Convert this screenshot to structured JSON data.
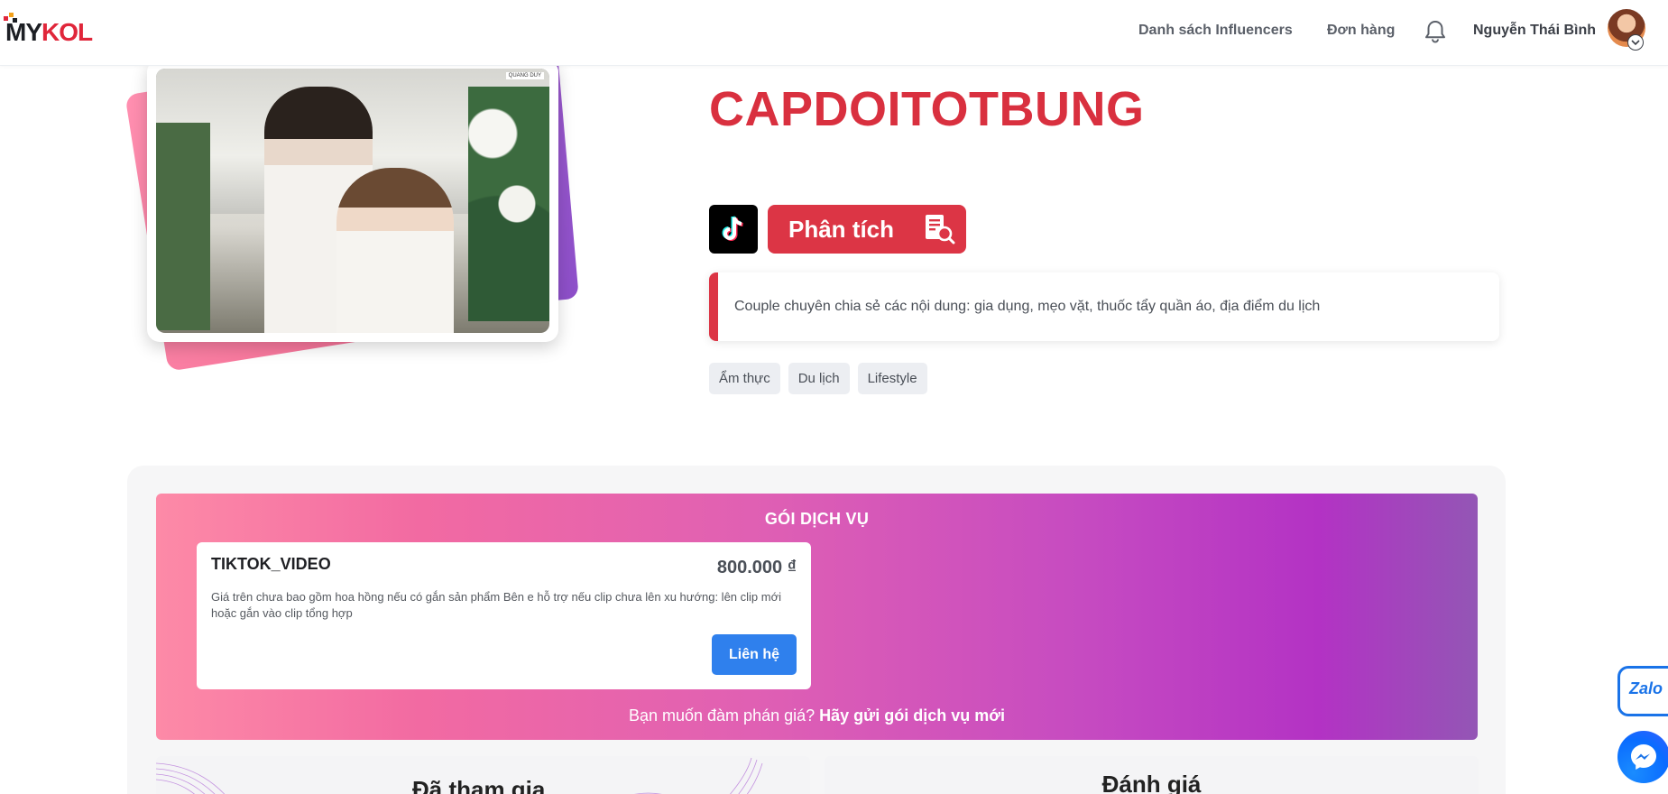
{
  "header": {
    "logo_prefix": "MY",
    "logo_suffix": "KOL",
    "nav_influencers": "Danh sách Influencers",
    "nav_orders": "Đơn hàng",
    "user_name": "Nguyễn Thái Bình",
    "icons": [
      "bell-icon",
      "avatar",
      "chevron-down-icon"
    ]
  },
  "profile": {
    "photo_watermark": "QUANG DUY",
    "name": "CAPDOITOTBUNG",
    "platform_icon": "tiktok-icon",
    "analyze_label": "Phân tích",
    "analyze_icon": "document-search-icon",
    "bio": "Couple chuyên chia sẻ các nội dung: gia dụng, mẹo vặt, thuốc tẩy quần áo, địa điểm du lịch",
    "tags": [
      "Ẩm thực",
      "Du lịch",
      "Lifestyle"
    ]
  },
  "services": {
    "title": "GÓI DỊCH VỤ",
    "packages": [
      {
        "name": "TIKTOK_VIDEO",
        "price": "800.000 ₫",
        "note": "Giá trên chưa bao gồm hoa hồng nếu có gắn sản phẩm Bên e hỗ trợ nếu clip chưa lên xu hướng: lên clip mới hoặc gắn vào clip tổng hợp",
        "contact_label": "Liên hệ"
      }
    ],
    "negotiate_text": "Bạn muốn đàm phán giá?",
    "negotiate_link": "Hãy gửi gói dịch vụ mới"
  },
  "sections": {
    "joined_title": "Đã tham gia",
    "review_title": "Đánh giá"
  },
  "floating": {
    "zalo_label": "Zalo",
    "messenger_icon": "messenger-icon"
  },
  "colors": {
    "brand_red": "#dc3545",
    "link_blue": "#2f80ed",
    "panel_gradient_start": "#fd8aa7",
    "panel_gradient_end": "#9356b5"
  }
}
